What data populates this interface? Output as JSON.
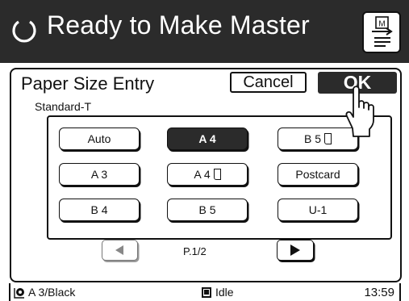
{
  "header": {
    "status_text": "Ready to Make Master",
    "master_icon_label": "M"
  },
  "dialog": {
    "title": "Paper Size Entry",
    "cancel_label": "Cancel",
    "ok_label": "OK",
    "group_label": "Standard-T",
    "sizes": [
      {
        "label": "Auto",
        "selected": false,
        "portrait": false
      },
      {
        "label": "A 4",
        "selected": true,
        "portrait": false
      },
      {
        "label": "B 5",
        "selected": false,
        "portrait": true
      },
      {
        "label": "A 3",
        "selected": false,
        "portrait": false
      },
      {
        "label": "A 4",
        "selected": false,
        "portrait": true
      },
      {
        "label": "Postcard",
        "selected": false,
        "portrait": false
      },
      {
        "label": "B 4",
        "selected": false,
        "portrait": false
      },
      {
        "label": "B 5",
        "selected": false,
        "portrait": false
      },
      {
        "label": "U-1",
        "selected": false,
        "portrait": false
      }
    ],
    "page_indicator": "P.1/2"
  },
  "statusbar": {
    "paper_info": "A 3/Black",
    "state": "Idle",
    "time": "13:59"
  },
  "colors": {
    "dark": "#2b2b2b",
    "light": "#ffffff"
  }
}
